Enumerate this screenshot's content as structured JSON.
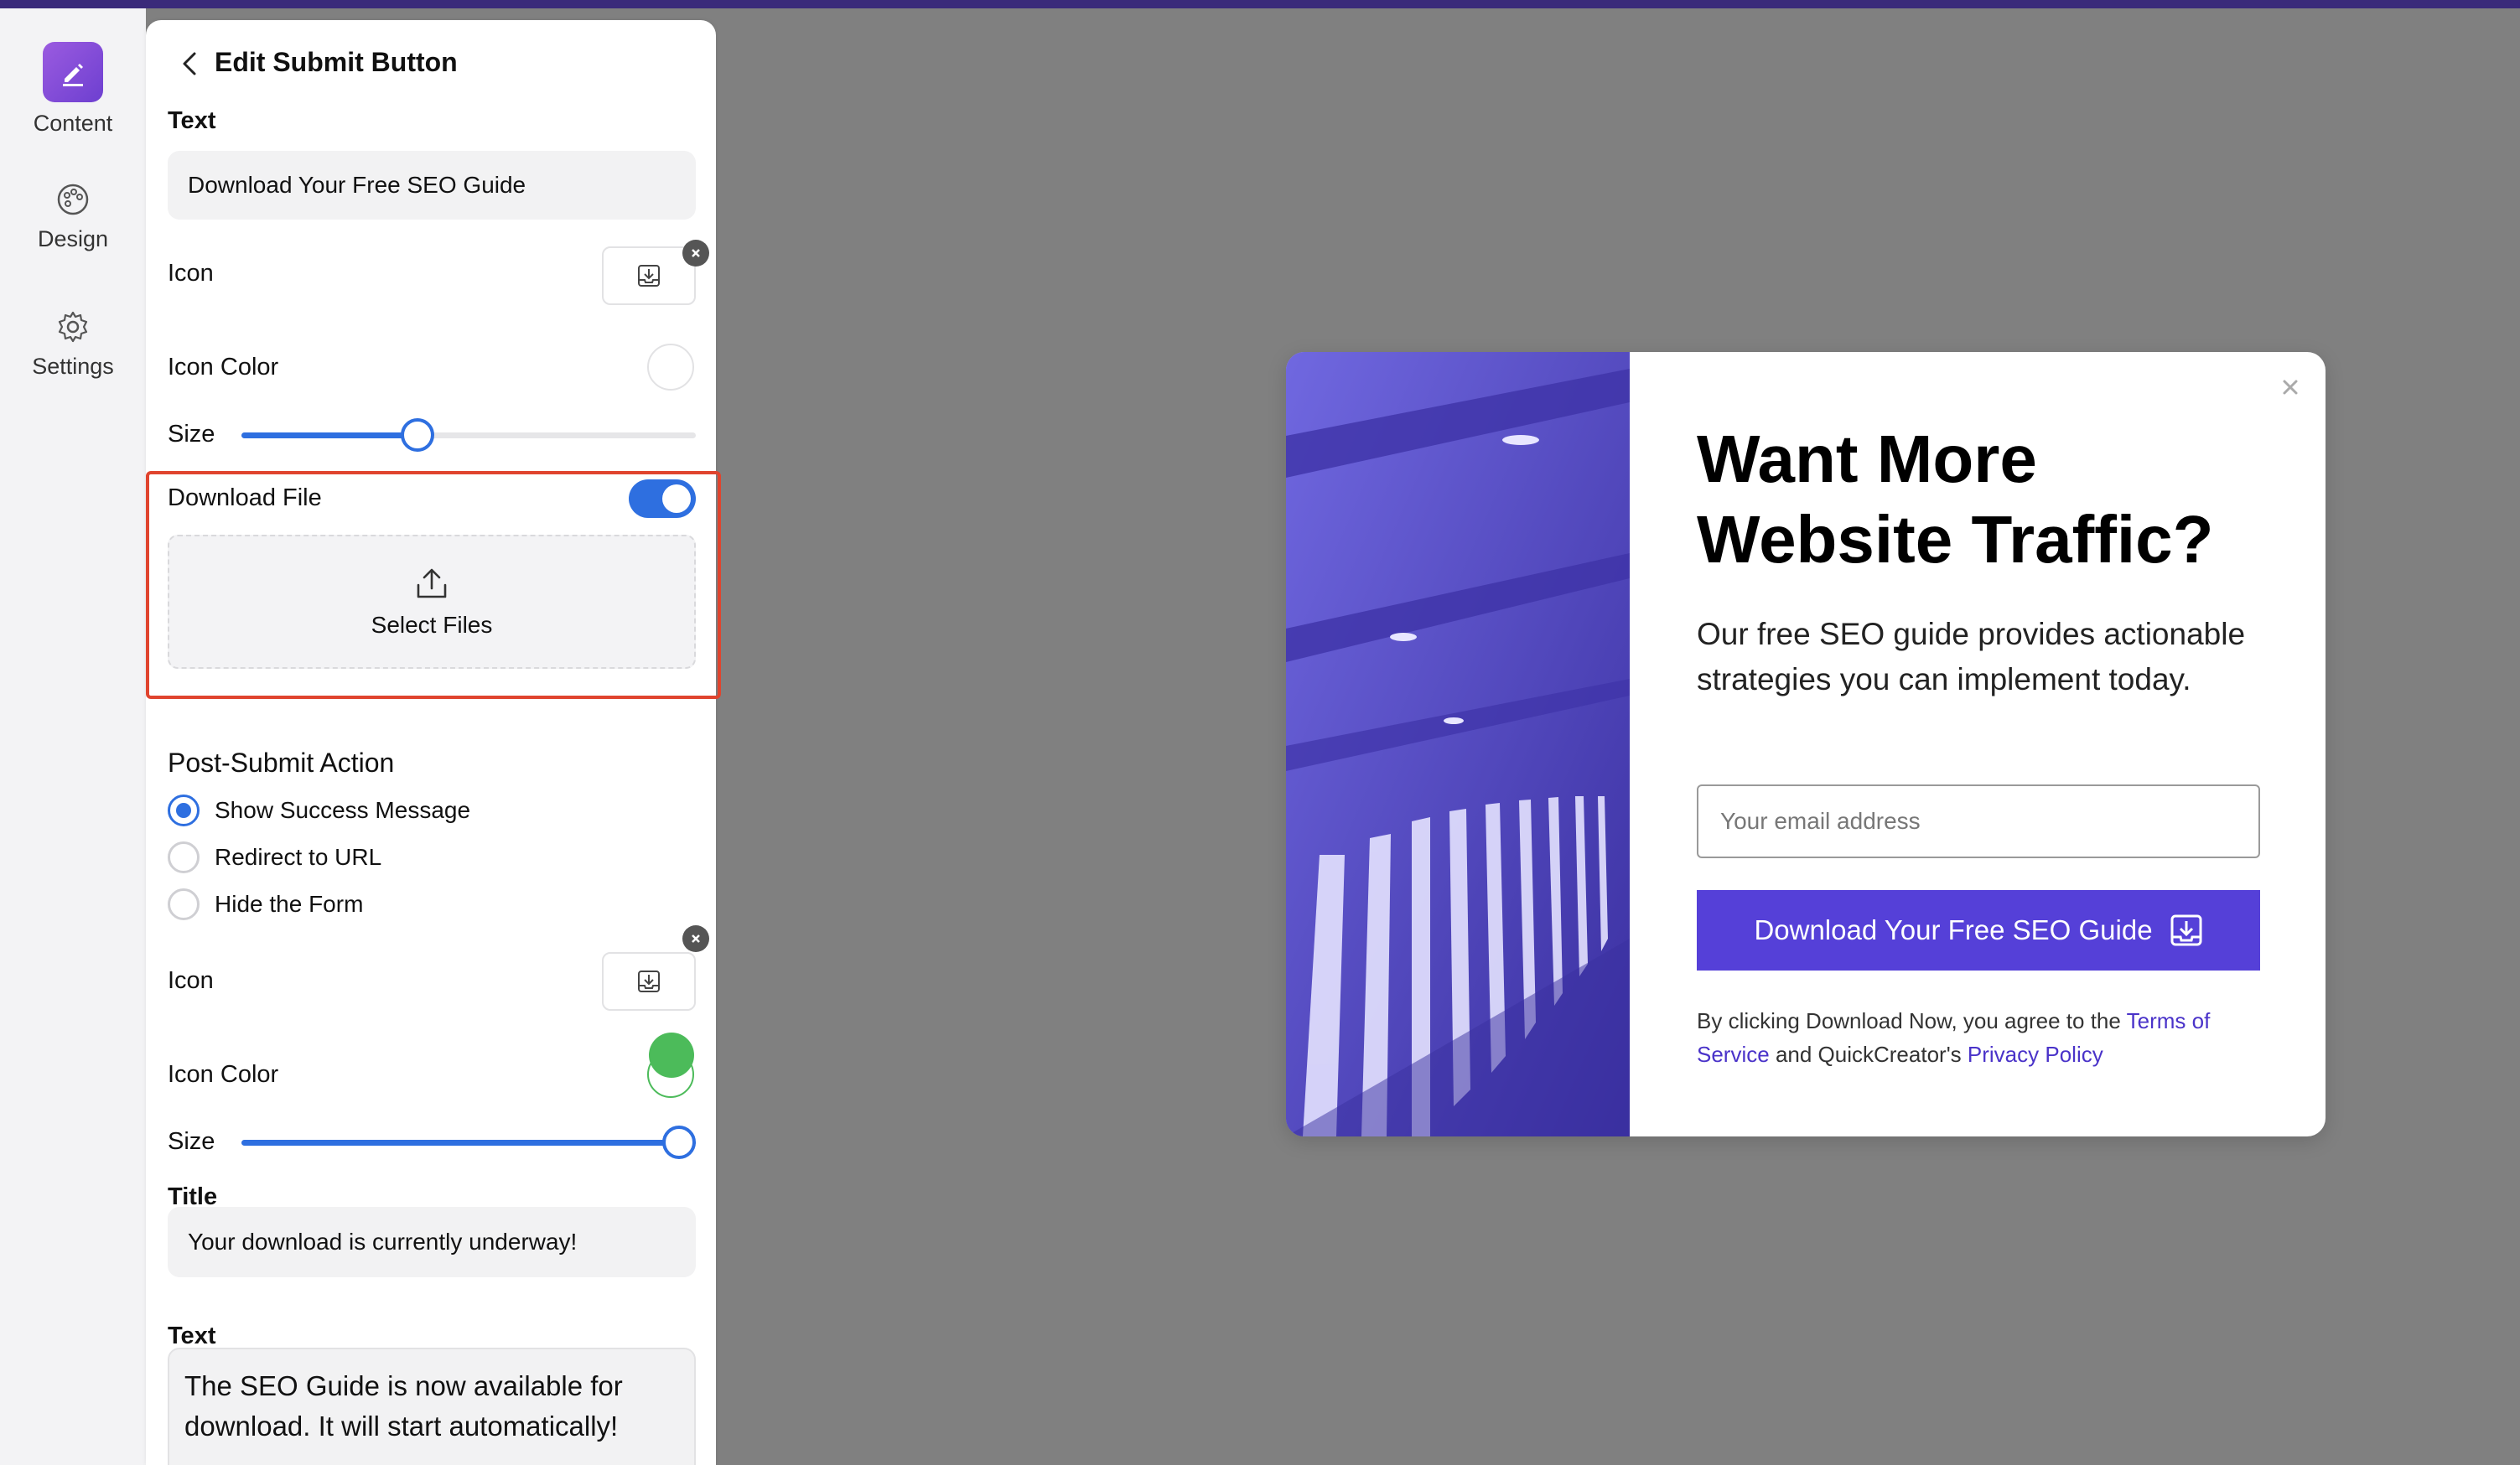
{
  "rail": {
    "items": [
      {
        "label": "Content"
      },
      {
        "label": "Design"
      },
      {
        "label": "Settings"
      }
    ]
  },
  "panel": {
    "title": "Edit Submit Button",
    "text_label": "Text",
    "text_value": "Download Your Free SEO Guide",
    "icon_label": "Icon",
    "icon_color_label": "Icon Color",
    "size_label": "Size",
    "size_value_pct": 39,
    "download_file_label": "Download File",
    "download_file_enabled": true,
    "select_files_label": "Select Files",
    "post_submit_label": "Post-Submit Action",
    "post_submit_options": [
      {
        "label": "Show Success Message",
        "selected": true
      },
      {
        "label": "Redirect to URL",
        "selected": false
      },
      {
        "label": "Hide the Form",
        "selected": false
      }
    ],
    "icon2_label": "Icon",
    "icon_color2_label": "Icon Color",
    "icon_color2": "#4cbb5a",
    "size2_label": "Size",
    "size2_value_pct": 100,
    "title_label": "Title",
    "title_value": "Your download is currently underway!",
    "text2_label": "Text",
    "text2_value": "The SEO Guide is now available for download. It will start automatically!"
  },
  "popup": {
    "title": "Want More Website Traffic?",
    "description": "Our free SEO guide provides actionable strategies you can implement today.",
    "email_placeholder": "Your email address",
    "cta_label": "Download Your Free SEO Guide",
    "legal_prefix": "By clicking Download Now, you agree to the",
    "terms_link": "Terms of Service",
    "legal_middle": "and QuickCreator's",
    "privacy_link": "Privacy Policy",
    "accent_color": "#5540d8"
  }
}
